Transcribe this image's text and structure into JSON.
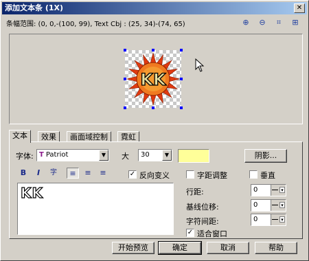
{
  "window": {
    "title": "添加文本条 (1X)",
    "close_symbol": "✕"
  },
  "range_text": "条幅范围: (0, 0,-(100, 99), Text Cbj : (25, 34)-(74, 65)",
  "zoom_icons": [
    "zoom-in-icon",
    "zoom-out-icon",
    "fit-icon",
    "actual-size-icon"
  ],
  "zoom_glyphs": [
    "⊕",
    "⊖",
    "⌗",
    "⊞"
  ],
  "preview": {
    "image_text": "KK",
    "sun_color": "#e03a10",
    "sun_face_color": "#f08020"
  },
  "tabs": [
    {
      "label": "文本",
      "active": true
    },
    {
      "label": "效果",
      "active": false
    },
    {
      "label": "画面域控制",
      "active": false
    },
    {
      "label": "霓虹",
      "active": false
    }
  ],
  "font": {
    "label": "字体:",
    "value": "Patriot",
    "icon_glyph": "T"
  },
  "size": {
    "label": "大",
    "value": "30"
  },
  "text_color": "#ffff99",
  "shadow_button": "阴影...",
  "format_buttons": [
    {
      "glyph": "B",
      "name": "bold"
    },
    {
      "glyph": "I",
      "name": "italic"
    },
    {
      "glyph": "字",
      "name": "underline"
    },
    {
      "glyph": "≡",
      "name": "align-left"
    },
    {
      "glyph": "≡",
      "name": "align-center"
    },
    {
      "glyph": "≡",
      "name": "align-right"
    }
  ],
  "antialias": {
    "label": "反向变义",
    "checked": true
  },
  "auto_kern": {
    "label": "字距调整",
    "checked": false
  },
  "vertical": {
    "label": "垂直",
    "checked": false
  },
  "text_content": "KK",
  "line_spacing": {
    "label": "行距:",
    "value": "0"
  },
  "baseline_shift": {
    "label": "基线位移:",
    "value": "0"
  },
  "char_spacing": {
    "label": "字符间距:",
    "value": "0"
  },
  "fit_window": {
    "label": "适合窗口",
    "checked": true
  },
  "buttons": {
    "preview": "开始预览",
    "ok": "确定",
    "cancel": "取消",
    "help": "帮助"
  }
}
